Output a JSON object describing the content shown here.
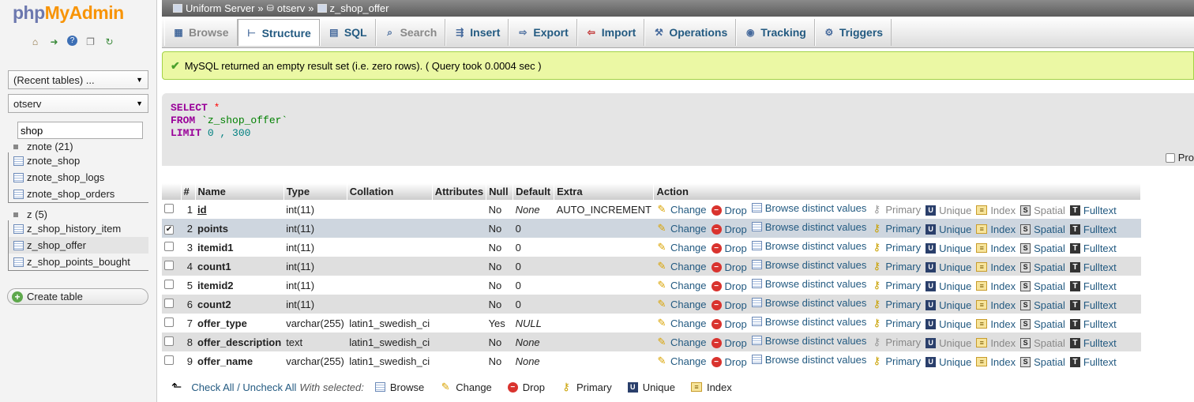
{
  "logo": {
    "php": "php",
    "myadmin": "MyAdmin"
  },
  "nav": {
    "icons": [
      "home-icon",
      "logout-icon",
      "help-icon",
      "docs-icon",
      "reload-icon"
    ],
    "recent_tables": "(Recent tables) ...",
    "database_select": "otserv",
    "filter_value": "shop",
    "groups": [
      {
        "name": "znote (21)",
        "tables": [
          "znote_shop",
          "znote_shop_logs",
          "znote_shop_orders"
        ]
      },
      {
        "name": "z (5)",
        "tables": [
          "z_shop_history_item",
          "z_shop_offer",
          "z_shop_points_bought"
        ]
      }
    ],
    "create_table": "Create table"
  },
  "breadcrumb": {
    "server": "Uniform Server",
    "sep": "»",
    "database": "otserv",
    "table": "z_shop_offer"
  },
  "tabs": [
    {
      "label": "Browse",
      "icon": "browse-icon",
      "disabled": true
    },
    {
      "label": "Structure",
      "icon": "structure-icon",
      "active": true
    },
    {
      "label": "SQL",
      "icon": "sql-icon"
    },
    {
      "label": "Search",
      "icon": "search-icon",
      "disabled": true
    },
    {
      "label": "Insert",
      "icon": "insert-icon"
    },
    {
      "label": "Export",
      "icon": "export-icon"
    },
    {
      "label": "Import",
      "icon": "import-icon"
    },
    {
      "label": "Operations",
      "icon": "wrench-icon"
    },
    {
      "label": "Tracking",
      "icon": "eye-icon"
    },
    {
      "label": "Triggers",
      "icon": "triggers-icon"
    }
  ],
  "message": "MySQL returned an empty result set (i.e. zero rows). ( Query took 0.0004 sec )",
  "query": {
    "select_kw": "SELECT",
    "select_rest": " *",
    "from_kw": "FROM",
    "from_rest": " `z_shop_offer`",
    "limit_kw": "LIMIT",
    "limit_a": " 0",
    "limit_sep": " ,",
    "limit_b": " 300"
  },
  "profiling_label": "Pro",
  "columns": [
    "#",
    "Name",
    "Type",
    "Collation",
    "Attributes",
    "Null",
    "Default",
    "Extra",
    "Action"
  ],
  "rows": [
    {
      "num": "1",
      "name": "id",
      "type": "int(11)",
      "collation": "",
      "attributes": "",
      "null": "No",
      "default": "None",
      "extra": "AUTO_INCREMENT",
      "pk": true
    },
    {
      "num": "2",
      "name": "points",
      "type": "int(11)",
      "collation": "",
      "attributes": "",
      "null": "No",
      "default": "0",
      "extra": "",
      "checked": true
    },
    {
      "num": "3",
      "name": "itemid1",
      "type": "int(11)",
      "collation": "",
      "attributes": "",
      "null": "No",
      "default": "0",
      "extra": ""
    },
    {
      "num": "4",
      "name": "count1",
      "type": "int(11)",
      "collation": "",
      "attributes": "",
      "null": "No",
      "default": "0",
      "extra": ""
    },
    {
      "num": "5",
      "name": "itemid2",
      "type": "int(11)",
      "collation": "",
      "attributes": "",
      "null": "No",
      "default": "0",
      "extra": ""
    },
    {
      "num": "6",
      "name": "count2",
      "type": "int(11)",
      "collation": "",
      "attributes": "",
      "null": "No",
      "default": "0",
      "extra": ""
    },
    {
      "num": "7",
      "name": "offer_type",
      "type": "varchar(255)",
      "collation": "latin1_swedish_ci",
      "attributes": "",
      "null": "Yes",
      "default": "NULL",
      "extra": ""
    },
    {
      "num": "8",
      "name": "offer_description",
      "type": "text",
      "collation": "latin1_swedish_ci",
      "attributes": "",
      "null": "No",
      "default": "None",
      "extra": ""
    },
    {
      "num": "9",
      "name": "offer_name",
      "type": "varchar(255)",
      "collation": "latin1_swedish_ci",
      "attributes": "",
      "null": "No",
      "default": "None",
      "extra": ""
    }
  ],
  "actions": [
    "Change",
    "Drop",
    "Browse distinct values",
    "Primary",
    "Unique",
    "Index",
    "Spatial",
    "Fulltext"
  ],
  "footer": {
    "check_all": "Check All",
    "slash": " / ",
    "uncheck_all": "Uncheck All",
    "with_selected": "With selected:",
    "actions": [
      "Browse",
      "Change",
      "Drop",
      "Primary",
      "Unique",
      "Index"
    ]
  }
}
